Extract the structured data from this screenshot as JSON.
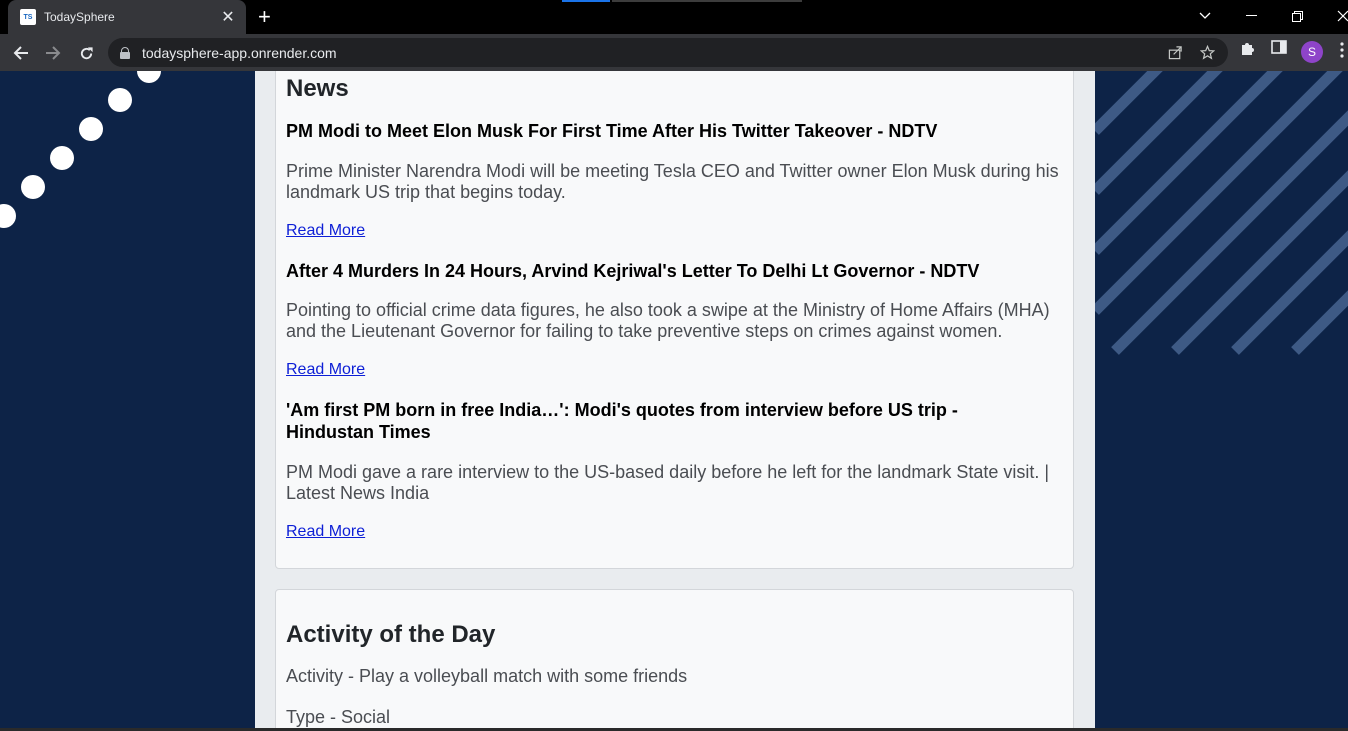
{
  "browser": {
    "tab_title": "TodaySphere",
    "favicon_text": "TS",
    "url": "todaysphere-app.onrender.com",
    "profile_initial": "S"
  },
  "news": {
    "heading": "News",
    "items": [
      {
        "title": "PM Modi to Meet Elon Musk For First Time After His Twitter Takeover - NDTV",
        "description": "Prime Minister Narendra Modi will be meeting Tesla CEO and Twitter owner Elon Musk during his landmark US trip that begins today.",
        "link_label": "Read More"
      },
      {
        "title": "After 4 Murders In 24 Hours, Arvind Kejriwal's Letter To Delhi Lt Governor - NDTV",
        "description": "Pointing to official crime data figures, he also took a swipe at the Ministry of Home Affairs (MHA) and the Lieutenant Governor for failing to take preventive steps on crimes against women.",
        "link_label": "Read More"
      },
      {
        "title": "'Am first PM born in free India…': Modi's quotes from interview before US trip - Hindustan Times",
        "description": "PM Modi gave a rare interview to the US-based daily before he left for the landmark State visit. | Latest News India",
        "link_label": "Read More"
      }
    ]
  },
  "activity": {
    "heading": "Activity of the Day",
    "activity_line": "Activity - Play a volleyball match with some friends",
    "type_line": "Type - Social"
  },
  "colors": {
    "page_background": "#0d2347",
    "link": "#0d1fd6",
    "card": "#f8f9fa"
  }
}
